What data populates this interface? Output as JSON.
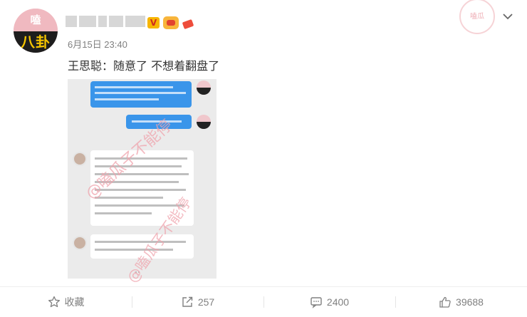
{
  "post": {
    "avatar_top_char": "嗑",
    "avatar_bottom_text": "八卦",
    "timestamp": "6月15日 23:40",
    "text": "王思聪：随意了 不想着翻盘了",
    "badge_v": "V",
    "watermark_text": "@嗑瓜子不能停",
    "watermark_seal": "嗑瓜"
  },
  "actions": [
    {
      "label": "收藏",
      "icon": "star-icon"
    },
    {
      "label": "257",
      "icon": "share-icon"
    },
    {
      "label": "2400",
      "icon": "comment-icon"
    },
    {
      "label": "39688",
      "icon": "like-icon"
    }
  ]
}
